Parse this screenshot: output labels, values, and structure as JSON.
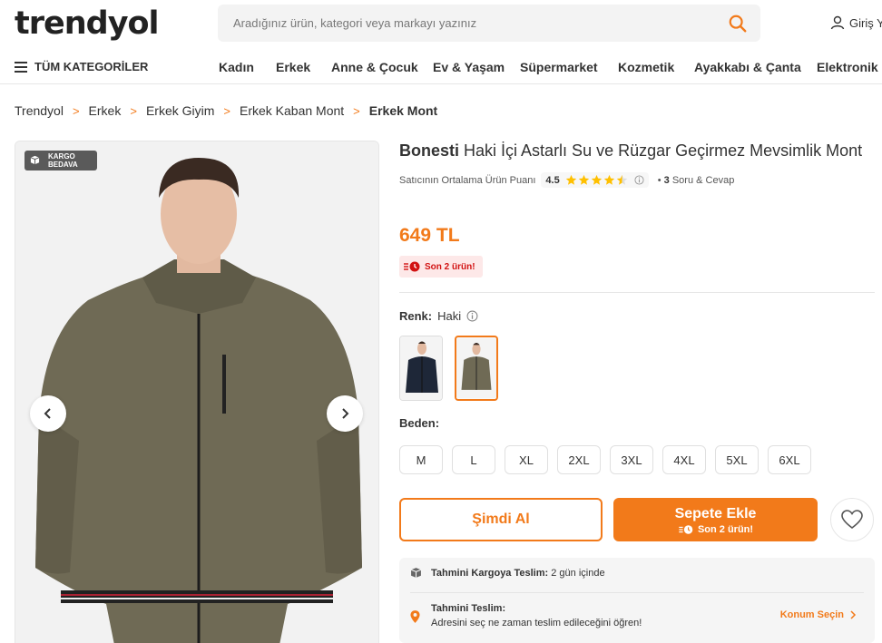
{
  "header": {
    "logo": "trendyol",
    "search_placeholder": "Aradığınız ürün, kategori veya markayı yazınız",
    "login_label": "Giriş Yap"
  },
  "nav": {
    "all_categories": "TÜM KATEGORİLER",
    "items": [
      "Kadın",
      "Erkek",
      "Anne & Çocuk",
      "Ev & Yaşam",
      "Süpermarket",
      "Kozmetik",
      "Ayakkabı & Çanta",
      "Elektronik"
    ]
  },
  "breadcrumb": [
    "Trendyol",
    "Erkek",
    "Erkek Giyim",
    "Erkek Kaban Mont",
    "Erkek Mont"
  ],
  "gallery": {
    "badge_line1": "KARGO",
    "badge_line2": "BEDAVA"
  },
  "product": {
    "brand": "Bonesti",
    "name": "Haki İçi Astarlı Su ve Rüzgar Geçirmez Mevsimlik Mont",
    "seller_rating_label": "Satıcının Ortalama Ürün Puanı",
    "rating": "4.5",
    "rating_value": 4.5,
    "qa_count": "3",
    "qa_label": "Soru & Cevap",
    "price": "649 TL",
    "stock_badge": "Son 2 ürün!",
    "color_label": "Renk:",
    "color_value": "Haki",
    "size_label": "Beden:",
    "sizes": [
      "M",
      "L",
      "XL",
      "2XL",
      "3XL",
      "4XL",
      "5XL",
      "6XL"
    ]
  },
  "actions": {
    "buy_now": "Şimdi Al",
    "add_to_cart": "Sepete Ekle",
    "cart_stock": "Son 2 ürün!"
  },
  "delivery": {
    "cargo_label": "Tahmini Kargoya Teslim:",
    "cargo_value": "2 gün içinde",
    "estimate_label": "Tahmini Teslim:",
    "estimate_text": "Adresini seç ne zaman teslim edileceğini öğren!",
    "location_link": "Konum Seçin"
  },
  "colors": {
    "brand_orange": "#f27a1a",
    "star": "#ffc000",
    "alert_red": "#d21313"
  }
}
